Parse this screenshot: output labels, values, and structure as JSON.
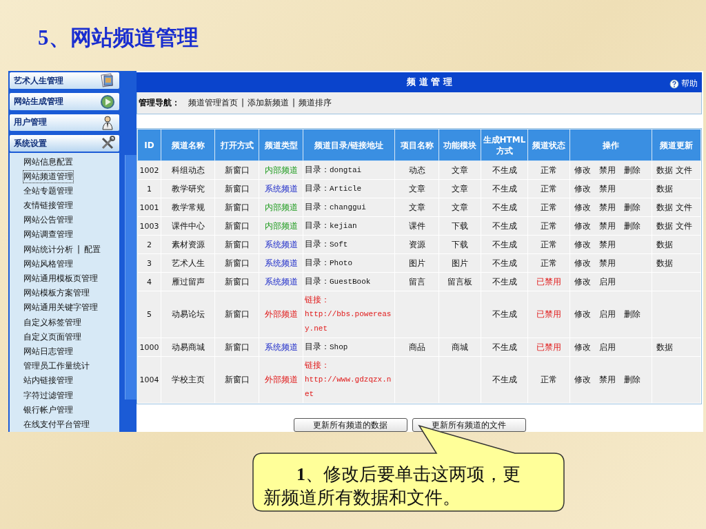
{
  "slide_title": "5、网站频道管理",
  "sidebar": {
    "separator": "|",
    "sections": [
      {
        "label": "艺术人生管理",
        "expanded": false
      },
      {
        "label": "网站生成管理",
        "expanded": false
      },
      {
        "label": "用户管理",
        "expanded": false
      },
      {
        "label": "系统设置",
        "expanded": true,
        "items": [
          {
            "label": "网站信息配置",
            "selected": false
          },
          {
            "label": "网站频道管理",
            "selected": true
          },
          {
            "label": "全站专题管理",
            "selected": false
          },
          {
            "label": "友情链接管理",
            "selected": false
          },
          {
            "label": "网站公告管理",
            "selected": false
          },
          {
            "label": "网站调查管理",
            "selected": false
          },
          {
            "label": "网站统计分析",
            "extra": "配置",
            "selected": false
          },
          {
            "label": "网站风格管理",
            "selected": false
          },
          {
            "label": "网站通用模板页管理",
            "selected": false
          },
          {
            "label": "网站模板方案管理",
            "selected": false
          },
          {
            "label": "网站通用关键字管理",
            "selected": false
          },
          {
            "label": "自定义标签管理",
            "selected": false
          },
          {
            "label": "自定义页面管理",
            "selected": false
          },
          {
            "label": "网站日志管理",
            "selected": false
          },
          {
            "label": "管理员工作量统计",
            "selected": false
          },
          {
            "label": "站内链接管理",
            "selected": false
          },
          {
            "label": "字符过滤管理",
            "selected": false
          },
          {
            "label": "银行帐户管理",
            "selected": false
          },
          {
            "label": "在线支付平台管理",
            "selected": false
          }
        ]
      }
    ]
  },
  "panel": {
    "title": "频 道 管 理",
    "help": "帮助"
  },
  "nav": {
    "label": "管理导航：",
    "separator": "|",
    "links": [
      "频道管理首页",
      "添加新频道",
      "频道排序"
    ]
  },
  "table": {
    "columns": [
      "ID",
      "频道名称",
      "打开方式",
      "频道类型",
      "频道目录/链接地址",
      "项目名称",
      "功能模块",
      "生成HTML方式",
      "频道状态",
      "操作",
      "频道更新"
    ],
    "rows": [
      {
        "id": "1002",
        "name": "科组动态",
        "open": "新窗口",
        "type": "内部频道",
        "kind": "internal",
        "path_label": "目录：",
        "path": "dongtai",
        "project": "动态",
        "module": "文章",
        "html": "不生成",
        "status": "正常",
        "disabled": false,
        "actions": [
          "修改",
          "禁用",
          "删除"
        ],
        "updates": [
          "数据",
          "文件"
        ]
      },
      {
        "id": "1",
        "name": "教学研究",
        "open": "新窗口",
        "type": "系统频道",
        "kind": "system",
        "path_label": "目录：",
        "path": "Article",
        "project": "文章",
        "module": "文章",
        "html": "不生成",
        "status": "正常",
        "disabled": false,
        "actions": [
          "修改",
          "禁用"
        ],
        "updates": [
          "数据"
        ]
      },
      {
        "id": "1001",
        "name": "教学常规",
        "open": "新窗口",
        "type": "内部频道",
        "kind": "internal",
        "path_label": "目录：",
        "path": "changgui",
        "project": "文章",
        "module": "文章",
        "html": "不生成",
        "status": "正常",
        "disabled": false,
        "actions": [
          "修改",
          "禁用",
          "删除"
        ],
        "updates": [
          "数据",
          "文件"
        ]
      },
      {
        "id": "1003",
        "name": "课件中心",
        "open": "新窗口",
        "type": "内部频道",
        "kind": "internal",
        "path_label": "目录：",
        "path": "kejian",
        "project": "课件",
        "module": "下载",
        "html": "不生成",
        "status": "正常",
        "disabled": false,
        "actions": [
          "修改",
          "禁用",
          "删除"
        ],
        "updates": [
          "数据",
          "文件"
        ]
      },
      {
        "id": "2",
        "name": "素材资源",
        "open": "新窗口",
        "type": "系统频道",
        "kind": "system",
        "path_label": "目录：",
        "path": "Soft",
        "project": "资源",
        "module": "下载",
        "html": "不生成",
        "status": "正常",
        "disabled": false,
        "actions": [
          "修改",
          "禁用"
        ],
        "updates": [
          "数据"
        ]
      },
      {
        "id": "3",
        "name": "艺术人生",
        "open": "新窗口",
        "type": "系统频道",
        "kind": "system",
        "path_label": "目录：",
        "path": "Photo",
        "project": "图片",
        "module": "图片",
        "html": "不生成",
        "status": "正常",
        "disabled": false,
        "actions": [
          "修改",
          "禁用"
        ],
        "updates": [
          "数据"
        ]
      },
      {
        "id": "4",
        "name": "雁过留声",
        "open": "新窗口",
        "type": "系统频道",
        "kind": "system",
        "path_label": "目录：",
        "path": "GuestBook",
        "project": "留言",
        "module": "留言板",
        "html": "不生成",
        "status": "已禁用",
        "disabled": true,
        "actions": [
          "修改",
          "启用"
        ]
      },
      {
        "id": "5",
        "name": "动易论坛",
        "open": "新窗口",
        "type": "外部频道",
        "kind": "external",
        "path_label": "链接：",
        "path": "http://bbs.powereasy.net",
        "html": "不生成",
        "status": "已禁用",
        "disabled": true,
        "actions": [
          "修改",
          "启用",
          "删除"
        ]
      },
      {
        "id": "1000",
        "name": "动易商城",
        "open": "新窗口",
        "type": "系统频道",
        "kind": "system",
        "path_label": "目录：",
        "path": "Shop",
        "project": "商品",
        "module": "商城",
        "html": "不生成",
        "status": "已禁用",
        "disabled": true,
        "actions": [
          "修改",
          "启用"
        ],
        "updates": [
          "数据"
        ]
      },
      {
        "id": "1004",
        "name": "学校主页",
        "open": "新窗口",
        "type": "外部频道",
        "kind": "external",
        "path_label": "链接：",
        "path": "http://www.gdzqzx.net",
        "html": "不生成",
        "status": "正常",
        "disabled": false,
        "actions": [
          "修改",
          "禁用",
          "删除"
        ]
      }
    ]
  },
  "buttons": [
    "更新所有频道的数据",
    "更新所有频道的文件"
  ],
  "callout": {
    "text": "**1**、修改后要单击这两项，更新频道所有数据和文件。"
  }
}
